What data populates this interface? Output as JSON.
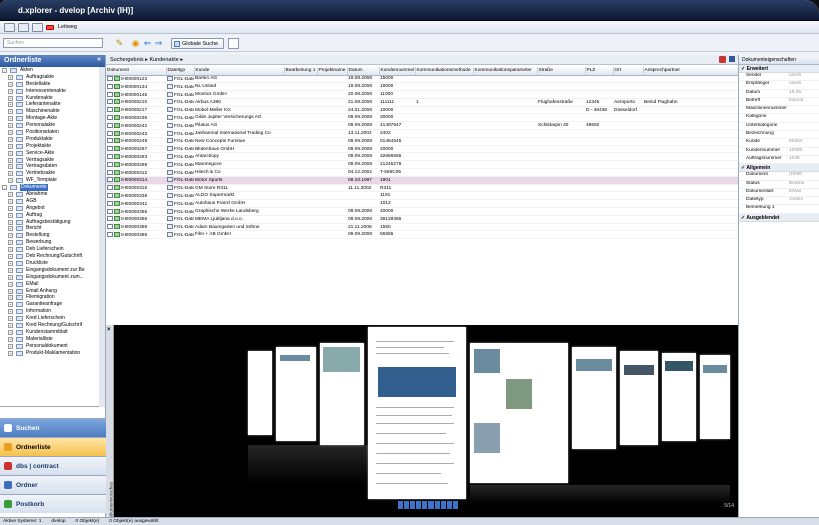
{
  "window": {
    "title": "d.xplorer - dvelop [Archiv (IH)]"
  },
  "menubar": {
    "item_label": "Leitweg"
  },
  "toolbar": {
    "search_placeholder": "Suchen",
    "global_search": "Globale Suche"
  },
  "left": {
    "title": "Ordnerliste",
    "tree": [
      {
        "label": "Akten",
        "level": 0,
        "sign": "-"
      },
      {
        "label": "Auftragsakte",
        "level": 1,
        "sign": "+"
      },
      {
        "label": "Bestellakte",
        "level": 1,
        "sign": "+"
      },
      {
        "label": "Interessentenakte",
        "level": 1,
        "sign": "+"
      },
      {
        "label": "Kundenakte",
        "level": 1,
        "sign": "+"
      },
      {
        "label": "Lieferantenakte",
        "level": 1,
        "sign": "+"
      },
      {
        "label": "Maschinenakte",
        "level": 1,
        "sign": "+"
      },
      {
        "label": "Montage-Akte",
        "level": 1,
        "sign": "+"
      },
      {
        "label": "Personalakte",
        "level": 1,
        "sign": "+"
      },
      {
        "label": "Positionsdaten",
        "level": 1,
        "sign": "+"
      },
      {
        "label": "Produktakte",
        "level": 1,
        "sign": "+"
      },
      {
        "label": "Projektakte",
        "level": 1,
        "sign": "+"
      },
      {
        "label": "Service-Akte",
        "level": 1,
        "sign": "+"
      },
      {
        "label": "Vertragsakte",
        "level": 1,
        "sign": "+"
      },
      {
        "label": "Vertragsdaten",
        "level": 1,
        "sign": "+"
      },
      {
        "label": "Vertriebsakte",
        "level": 1,
        "sign": "+"
      },
      {
        "label": "WF_Template",
        "level": 1,
        "sign": "+"
      },
      {
        "label": "Dokumente",
        "level": 0,
        "sign": "-",
        "selected": true
      },
      {
        "label": "Abnahme",
        "level": 1,
        "sign": "+"
      },
      {
        "label": "AGB",
        "level": 1,
        "sign": "+"
      },
      {
        "label": "Angebot",
        "level": 1,
        "sign": "+"
      },
      {
        "label": "Auftrag",
        "level": 1,
        "sign": "+"
      },
      {
        "label": "Auftragsbestätigung",
        "level": 1,
        "sign": "+"
      },
      {
        "label": "Bericht",
        "level": 1,
        "sign": "+"
      },
      {
        "label": "Bestellung",
        "level": 1,
        "sign": "+"
      },
      {
        "label": "Bewerbung",
        "level": 1,
        "sign": "+"
      },
      {
        "label": "Deb Lieferschein",
        "level": 1,
        "sign": "+"
      },
      {
        "label": "Deb Rechnung/Gutschrift",
        "level": 1,
        "sign": "+"
      },
      {
        "label": "Druckliste",
        "level": 1,
        "sign": "+"
      },
      {
        "label": "Eingangsdokument zur Be",
        "level": 1,
        "sign": "+"
      },
      {
        "label": "Eingangsdokument zum...",
        "level": 1,
        "sign": "+"
      },
      {
        "label": "EMail",
        "level": 1,
        "sign": "+"
      },
      {
        "label": "Email Anhang",
        "level": 1,
        "sign": "+"
      },
      {
        "label": "Filemigration",
        "level": 1,
        "sign": "+"
      },
      {
        "label": "Garantieanfrage",
        "level": 1,
        "sign": "+"
      },
      {
        "label": "Information",
        "level": 1,
        "sign": "+"
      },
      {
        "label": "Kred Lieferschein",
        "level": 1,
        "sign": "+"
      },
      {
        "label": "Kred Rechnung/Gutschrif",
        "level": 1,
        "sign": "+"
      },
      {
        "label": "Kundenstammblatt",
        "level": 1,
        "sign": "+"
      },
      {
        "label": "Materialliste",
        "level": 1,
        "sign": "+"
      },
      {
        "label": "Personaldokument",
        "level": 1,
        "sign": "+"
      },
      {
        "label": "Produkt-Maklamentation",
        "level": 1,
        "sign": "+"
      }
    ],
    "nav": [
      {
        "label": "Suchen",
        "style": "blue",
        "color": "#ffffff"
      },
      {
        "label": "Ordnerliste",
        "style": "act",
        "color": "#e8a020"
      },
      {
        "label": "dbs | contract",
        "style": "",
        "color": "#d03030"
      },
      {
        "label": "Ordner",
        "style": "",
        "color": "#3d6fc1"
      },
      {
        "label": "Postkorb",
        "style": "",
        "color": "#3a9a3a"
      }
    ]
  },
  "center": {
    "breadcrumb": "Suchergebnis  ▸  Kundenakte  ▸",
    "columns": [
      "Dokument",
      "Dateityp",
      "Kunde",
      "Bearbeitung 1",
      "Projektname",
      "Datum",
      "Kundennummer",
      "Kommunikationsmethode",
      "Kommunikationsparameter",
      "Straße",
      "PLZ",
      "Ort",
      "Ansprechpartner"
    ],
    "rows": [
      [
        "IH00000123",
        "FOL-Datei",
        "Barten AG",
        "",
        "",
        "19.08.2008",
        "15000",
        "",
        "",
        "",
        "",
        "",
        ""
      ],
      [
        "IH00000134",
        "FOL-Datei",
        "NL United",
        "",
        "",
        "19.08.2008",
        "19000",
        "",
        "",
        "",
        "",
        "",
        ""
      ],
      [
        "IH00000145",
        "FOL-Datei",
        "Montics GmbH",
        "",
        "",
        "20.08.2008",
        "11000",
        "",
        "",
        "",
        "",
        "",
        ""
      ],
      [
        "IH00000210",
        "FOL-Datei",
        "Airbus A380",
        "",
        "",
        "21.08.2008",
        "111111",
        "1",
        "",
        "Flughafenstraße",
        "12345",
        "Aeroporto",
        "Beind Flughahn"
      ],
      [
        "IH00000217",
        "FOL-Datei",
        "Mobel-Meller KG",
        "",
        "",
        "24.01.2008",
        "10000",
        "",
        "",
        "",
        "D - 48436",
        "Düsseldorf",
        ""
      ],
      [
        "IH00000235",
        "FOL-Datei",
        "Gilde Jupiter Versicherungs AG",
        "",
        "",
        "09.09.2008",
        "30000",
        "",
        "",
        "",
        "",
        "",
        ""
      ],
      [
        "IH00000242",
        "FOL-Datei",
        "Pilatus AG",
        "",
        "",
        "09.09.2008",
        "41497647",
        "",
        "",
        "Schildarpin 40",
        "48692",
        "",
        ""
      ],
      [
        "IH00000243",
        "FOL-Datei",
        "Jashanmal International Trading Co",
        "",
        "",
        "13.11.2002",
        "2402",
        "",
        "",
        "",
        "",
        "",
        ""
      ],
      [
        "IH00000249",
        "FOL-Datei",
        "New Concepts Furnitue",
        "",
        "",
        "09.09.2008",
        "01454545",
        "",
        "",
        "",
        "",
        "",
        ""
      ],
      [
        "IH00000267",
        "FOL-Datei",
        "Blütenhaus GmbH",
        "",
        "",
        "09.09.2008",
        "20000",
        "",
        "",
        "",
        "",
        "",
        ""
      ],
      [
        "IH00000293",
        "FOL-Datei",
        "Antarctiopy",
        "",
        "",
        "09.09.2008",
        "32656565",
        "",
        "",
        "",
        "",
        "",
        ""
      ],
      [
        "IH00000298",
        "FOL-Datei",
        "Maronegoce",
        "",
        "",
        "09.09.2008",
        "21245278",
        "",
        "",
        "",
        "",
        "",
        ""
      ],
      [
        "IH00000312",
        "FOL-Datei",
        "Hitech & Co",
        "",
        "",
        "04.12.2002",
        "T-566C05",
        "",
        "",
        "",
        "",
        "",
        ""
      ],
      [
        "IH00000314",
        "FOL-Datei",
        "Motor Sports",
        "",
        "",
        "09.10.1997",
        "1901",
        "",
        "",
        "",
        "",
        "",
        ""
      ],
      [
        "IH00000315",
        "FOL-Datei",
        "GM Store R311",
        "",
        "",
        "11.11.2002",
        "R311",
        "",
        "",
        "",
        "",
        "",
        ""
      ],
      [
        "IH00000338",
        "FOL-Datei",
        "ALDO Supermarkt",
        "",
        "",
        "",
        "1191",
        "",
        "",
        "",
        "",
        "",
        ""
      ],
      [
        "IH00000341",
        "FOL-Datei",
        "Autohaus Franzl GmbH",
        "",
        "",
        "",
        "1012",
        "",
        "",
        "",
        "",
        "",
        ""
      ],
      [
        "IH00000355",
        "FOL-Datei",
        "Graphische Werke Landsberg",
        "",
        "",
        "09.09.2008",
        "40000",
        "",
        "",
        "",
        "",
        "",
        ""
      ],
      [
        "IH00000356",
        "FOL-Datei",
        "MEMA Ljubljana d.o.o.",
        "",
        "",
        "09.09.2008",
        "38128456",
        "",
        "",
        "",
        "",
        "",
        ""
      ],
      [
        "IH00000358",
        "FOL-Datei",
        "Adam Baumgarten und Söhne",
        "",
        "",
        "21.11.2008",
        "1550",
        "",
        "",
        "",
        "",
        "",
        ""
      ],
      [
        "IH00000365",
        "FOL-Datei",
        "Film + AB GmbH",
        "",
        "",
        "09.09.2008",
        "55555",
        "",
        "",
        "",
        "",
        "",
        ""
      ]
    ],
    "highlight_row": 13,
    "preview_label": "Dokumentvorschau",
    "page_counter": "5/14"
  },
  "right": {
    "title": "Dokumenteigenschaften",
    "sections": [
      {
        "title": "Erweitert",
        "props": [
          [
            "Sender",
            "user5"
          ],
          [
            "Empfänger",
            "user5"
          ],
          [
            "Datum",
            "18.06."
          ],
          [
            "Betreff",
            "Kilimar"
          ],
          [
            "Maschinennummer",
            ""
          ],
          [
            "Kategorie",
            ""
          ],
          [
            "Unterkategorie",
            ""
          ],
          [
            "Bezeichnung",
            ""
          ],
          [
            "Kunde",
            "Möbel"
          ],
          [
            "Kundennummer",
            "10000"
          ],
          [
            "Auftragsnummer",
            "1038"
          ]
        ]
      },
      {
        "title": "Allgemein",
        "props": [
          [
            "Dokument",
            "(H000"
          ],
          [
            "Status",
            "Bearbe"
          ],
          [
            "Dokumentart",
            "EMail"
          ],
          [
            "Dateityp",
            "Outloo"
          ],
          [
            "Bemerkung 1",
            ""
          ]
        ]
      },
      {
        "title": "Ausgeblendet",
        "props": []
      }
    ]
  },
  "status": {
    "system": "Aktive Systeme: 1",
    "user": "dvelop",
    "count": "0 Objekt(e)",
    "selected": "0 Objekt(e) ausgewählt"
  }
}
